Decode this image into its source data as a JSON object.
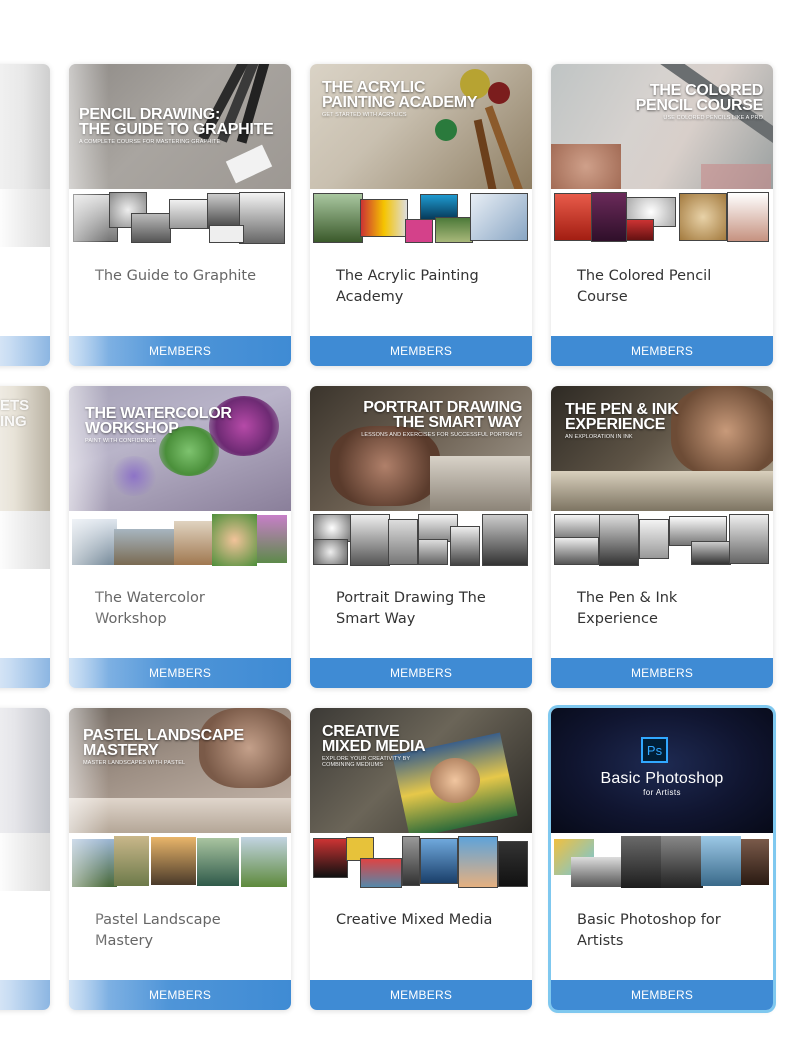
{
  "courses": [
    {
      "thumb_lines": [
        "Pencil Drawing:",
        "The Guide to Graphite"
      ],
      "thumb_sub": "A complete course for mastering graphite",
      "title": "The Guide to Graphite",
      "footer": "MEMBERS"
    },
    {
      "thumb_lines": [
        "The Acrylic",
        "Painting Academy"
      ],
      "thumb_sub": "Get started with acrylics",
      "title": "The Acrylic Painting Academy",
      "footer": "MEMBERS"
    },
    {
      "thumb_lines": [
        "The Colored",
        "Pencil Course"
      ],
      "thumb_sub": "Use colored pencils like a pro",
      "title": "The Colored Pencil Course",
      "footer": "MEMBERS"
    },
    {
      "thumb_lines": [
        "The Watercolor",
        "Workshop"
      ],
      "thumb_sub": "Paint with confidence",
      "title": "The Watercolor Workshop",
      "footer": "MEMBERS"
    },
    {
      "thumb_lines": [
        "Portrait Drawing",
        "The Smart Way"
      ],
      "thumb_sub": "Lessons and exercises for successful portraits",
      "title": "Portrait Drawing The Smart Way",
      "footer": "MEMBERS"
    },
    {
      "thumb_lines": [
        "The Pen & Ink",
        "Experience"
      ],
      "thumb_sub": "An exploration in ink",
      "title": "The Pen & Ink Experience",
      "footer": "MEMBERS"
    },
    {
      "thumb_lines": [
        "Pastel Landscape",
        "Mastery"
      ],
      "thumb_sub": "Master landscapes with pastel",
      "title": "Pastel Landscape Mastery",
      "footer": "MEMBERS"
    },
    {
      "thumb_lines": [
        "Creative",
        "Mixed Media"
      ],
      "thumb_sub": "Explore your creativity by combining mediums",
      "title": "Creative Mixed Media",
      "footer": "MEMBERS"
    },
    {
      "thumb_lines": [
        "Basic Photoshop",
        "for Artists"
      ],
      "thumb_sub": "",
      "logo_text": "Ps",
      "title": "Basic Photoshop for Artists",
      "footer": "MEMBERS"
    }
  ],
  "partial_column": [
    {
      "thumb_lines": []
    },
    {
      "thumb_lines": [
        "ETS",
        "ING"
      ]
    },
    {
      "thumb_lines": []
    }
  ],
  "colors": {
    "footer_blue": "#3f8bd4",
    "highlight_border": "#7fc8ef",
    "title_text": "#333333"
  }
}
